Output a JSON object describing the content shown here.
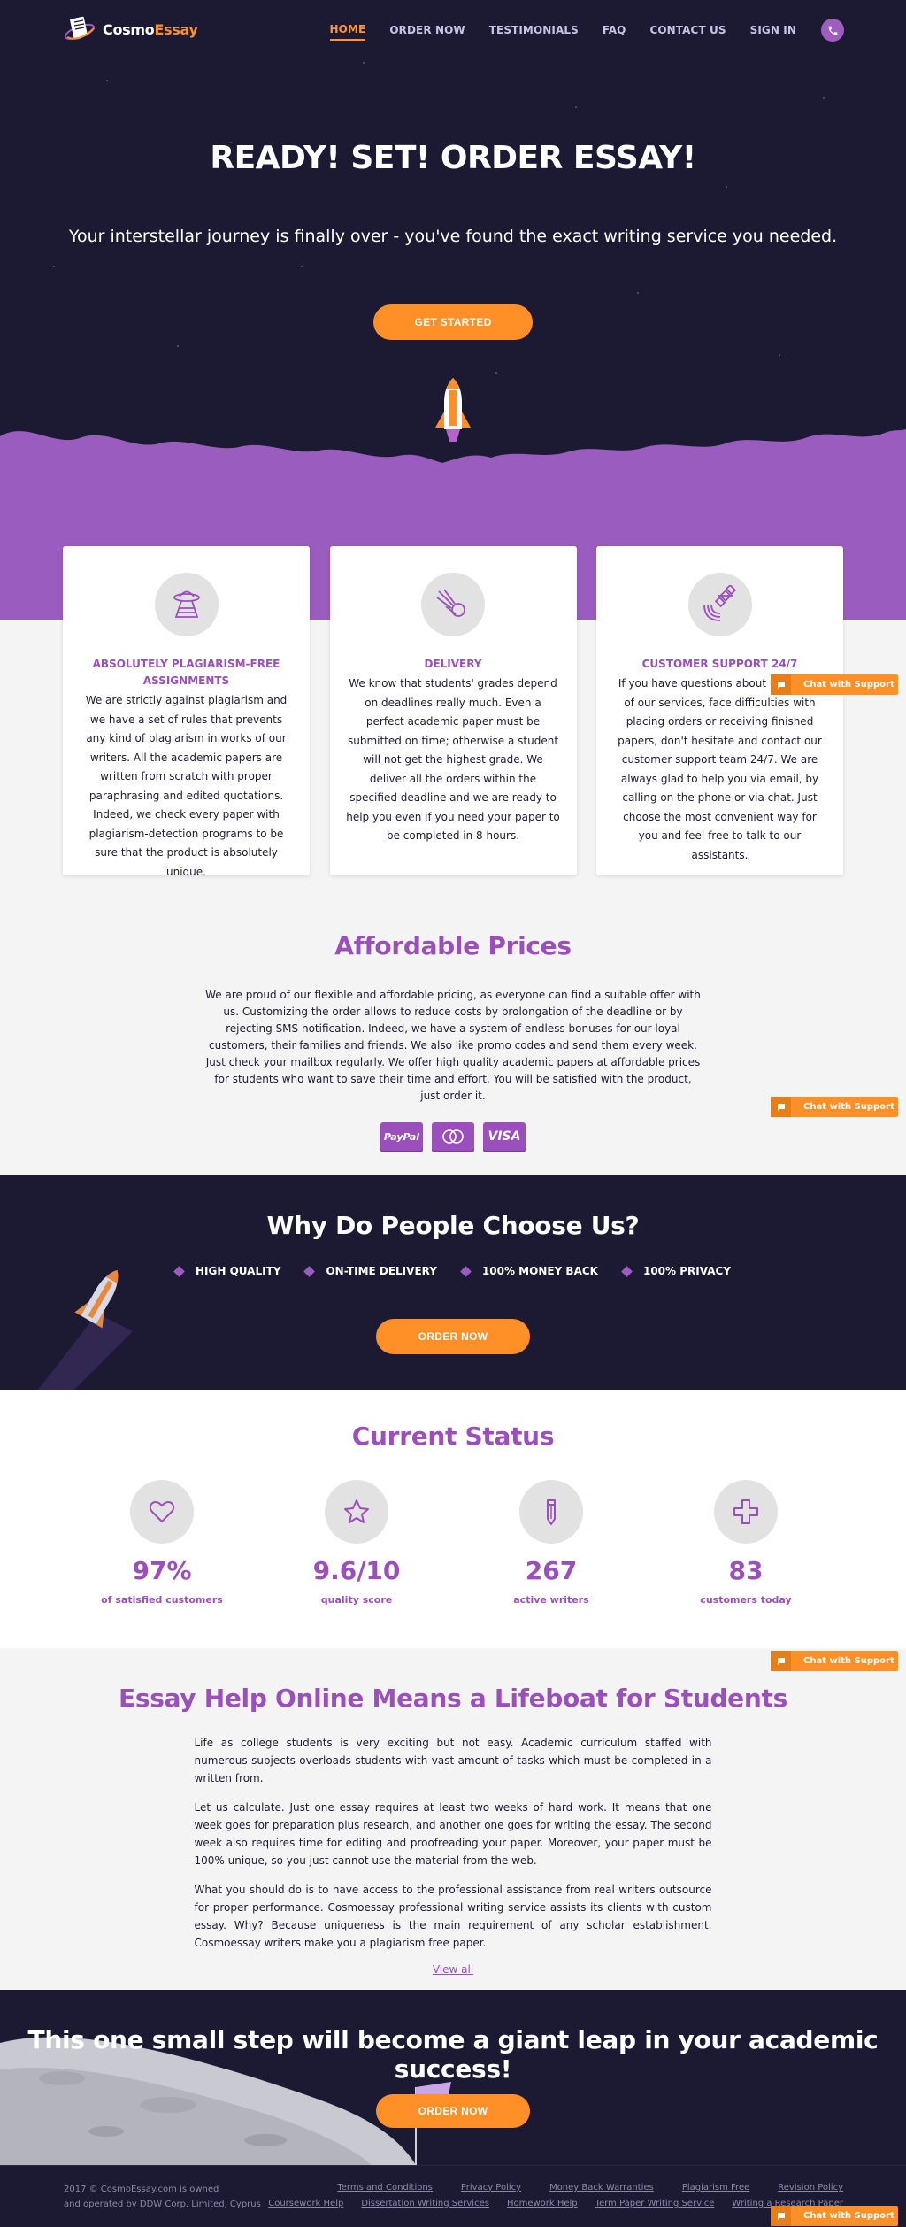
{
  "brand": {
    "name_part1": "Cosmo",
    "name_part2": "Essay"
  },
  "nav": {
    "items": [
      "HOME",
      "ORDER NOW",
      "TESTIMONIALS",
      "FAQ",
      "CONTACT US",
      "SIGN IN"
    ],
    "active": "HOME"
  },
  "hero": {
    "title": "READY! SET! ORDER ESSAY!",
    "subtitle": "Your interstellar journey is finally over - you've found the exact writing service you needed.",
    "cta": "GET STARTED"
  },
  "features": [
    {
      "icon": "ufo-icon",
      "title": "ABSOLUTELY PLAGIARISM-FREE ASSIGNMENTS",
      "text": "We are strictly against plagiarism and we have a set of rules that prevents any kind of plagiarism in works of our writers. All the academic papers are written from scratch with proper paraphrasing and edited quotations. Indeed, we check every paper with plagiarism-detection programs to be sure that the product is absolutely unique."
    },
    {
      "icon": "comet-icon",
      "title": "DELIVERY",
      "text": "We know that students' grades depend on deadlines really much. Even a perfect academic paper must be submitted on time; otherwise a student will not get the highest grade. We deliver all the orders within the specified deadline and we are ready to help you even if you need your paper to be completed in 8 hours."
    },
    {
      "icon": "satellite-icon",
      "title": "CUSTOMER SUPPORT 24/7",
      "text": "If you have questions about using any of our services, face difficulties with placing orders or receiving finished papers, don't hesitate and contact our customer support team 24/7. We are always glad to help you via email, by calling on the phone or via chat. Just choose the most convenient way for you and feel free to talk to our assistants."
    }
  ],
  "chat": {
    "label": "Chat with Support"
  },
  "prices": {
    "title": "Affordable Prices",
    "text": "We are proud of our flexible and affordable pricing, as everyone can find a suitable offer with us. Customizing the order allows to reduce costs by prolongation of the deadline or by rejecting SMS notification. Indeed, we have a system of endless bonuses for our loyal customers, their families and friends. We also like promo codes and send them every week. Just check your mailbox regularly. We offer high quality academic papers at affordable prices for students who want to save their time and effort. You will be satisfied with the product, just order it.",
    "payments": [
      "PayPal",
      "",
      "VISA"
    ]
  },
  "why": {
    "title": "Why Do People Choose Us?",
    "items": [
      "HIGH QUALITY",
      "ON-TIME DELIVERY",
      "100% MONEY BACK",
      "100% PRIVACY"
    ],
    "cta": "ORDER NOW"
  },
  "status": {
    "title": "Current Status",
    "stats": [
      {
        "icon": "heart-icon",
        "value": "97%",
        "label": "of satisfied customers"
      },
      {
        "icon": "star-icon",
        "value": "9.6/10",
        "label": "quality score"
      },
      {
        "icon": "pencil-icon",
        "value": "267",
        "label": "active writers"
      },
      {
        "icon": "plus-icon",
        "value": "83",
        "label": "customers today"
      }
    ]
  },
  "essay": {
    "title": "Essay Help Online Means a Lifeboat for Students",
    "paragraphs": [
      "Life as college students is very exciting but not easy. Academic curriculum staffed with numerous subjects overloads students with vast amount of tasks which must be completed in a written from.",
      "Let us calculate. Just one essay requires at least two weeks of hard work. It means that one week goes for preparation plus research, and another one goes for writing the essay. The second week also requires time for editing and proofreading your paper. Moreover, your paper must be 100% unique, so you just cannot use the material from the web.",
      "What you should do is to have access to the professional assistance from real writers outsource for proper performance. Cosmoessay professional writing service assists its clients with custom essay. Why? Because uniqueness is the main requirement of any scholar establishment. Cosmoessay writers make you a plagiarism free paper."
    ],
    "view_all": "View all"
  },
  "leap": {
    "title": "This one small step will become a giant leap in your academic success!",
    "cta": "ORDER NOW"
  },
  "footer": {
    "copyright_line1": "2017 © CosmoEssay.com is owned",
    "copyright_line2": "and operated by DDW Corp. Limited, Cyprus",
    "links_row1": [
      "Terms and Conditions",
      "Privacy Policy",
      "Money Back Warranties",
      "Plagiarism Free",
      "Revision Policy"
    ],
    "links_row2": [
      "Coursework Help",
      "Dissertation Writing Services",
      "Homework Help",
      "Term Paper Writing Service",
      "Writing a Research Paper"
    ]
  },
  "colors": {
    "dark": "#1c1a33",
    "purple": "#9b4fbd",
    "orange": "#ff8f26"
  }
}
